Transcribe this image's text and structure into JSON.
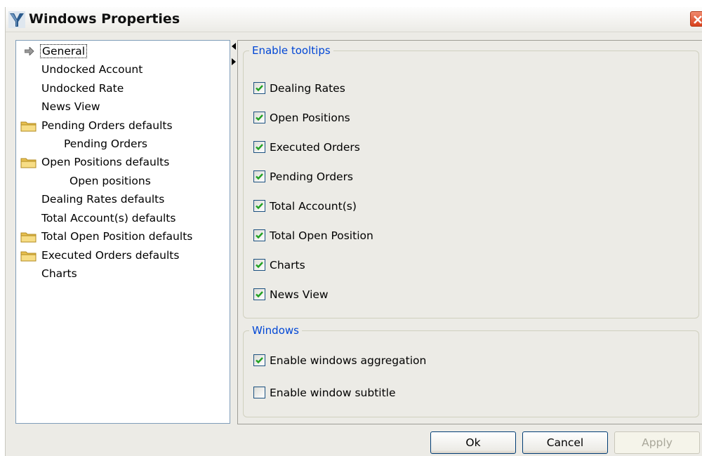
{
  "window": {
    "title": "Windows Properties",
    "app_icon": "y-logo-icon",
    "close_icon": "close-x-icon"
  },
  "tree": {
    "items": [
      {
        "label": "General",
        "selected": true,
        "icon": "arrow-right-icon"
      },
      {
        "label": "Undocked Account"
      },
      {
        "label": "Undocked Rate"
      },
      {
        "label": "News View"
      },
      {
        "label": "Pending Orders defaults",
        "icon": "folder-icon"
      },
      {
        "label": "Pending Orders"
      },
      {
        "label": "Open Positions defaults",
        "icon": "folder-icon"
      },
      {
        "label": "Open positions"
      },
      {
        "label": "Dealing Rates defaults"
      },
      {
        "label": "Total Account(s) defaults"
      },
      {
        "label": "Total Open Position defaults",
        "icon": "folder-icon"
      },
      {
        "label": "Executed Orders defaults",
        "icon": "folder-icon"
      },
      {
        "label": "Charts"
      }
    ]
  },
  "tooltips": {
    "legend": "Enable tooltips",
    "items": [
      {
        "label": "Dealing Rates",
        "checked": true
      },
      {
        "label": "Open Positions",
        "checked": true
      },
      {
        "label": "Executed Orders",
        "checked": true
      },
      {
        "label": "Pending Orders",
        "checked": true
      },
      {
        "label": "Total Account(s)",
        "checked": true
      },
      {
        "label": "Total Open Position",
        "checked": true
      },
      {
        "label": "Charts",
        "checked": true
      },
      {
        "label": "News View",
        "checked": true
      }
    ]
  },
  "windows": {
    "legend": "Windows",
    "items": [
      {
        "label": "Enable windows aggregation",
        "checked": true
      },
      {
        "label": "Enable window subtitle",
        "checked": false
      }
    ]
  },
  "buttons": {
    "ok": "Ok",
    "cancel": "Cancel",
    "apply": "Apply"
  },
  "colors": {
    "legend": "#0046d5",
    "check": "#21a121",
    "panel": "#ecebe6"
  }
}
